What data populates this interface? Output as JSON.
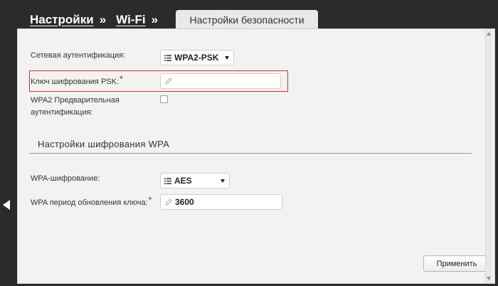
{
  "breadcrumb": {
    "items": [
      "Настройки",
      "Wi-Fi"
    ],
    "separator": "»"
  },
  "active_tab": "Настройки безопасности",
  "form": {
    "network_auth": {
      "label": "Сетевая аутентификация:",
      "value": "WPA2-PSK"
    },
    "psk_key": {
      "label": "Ключ шифрования PSK:",
      "required_mark": "*",
      "value": ""
    },
    "preauth": {
      "label_line1": "WPA2 Предварительная",
      "label_line2": "аутентификация:",
      "checked": false
    }
  },
  "wpa_section": {
    "title": "Настройки шифрования WPA",
    "encryption": {
      "label": "WPA-шифрование:",
      "value": "AES"
    },
    "key_update": {
      "label": "WPA период обновления ключа:",
      "required_mark": "*",
      "value": "3600"
    }
  },
  "apply_button": "Применить",
  "colors": {
    "background": "#2b2b2b",
    "panel": "#f2f2f2",
    "highlight_border": "#d32f2f",
    "required": "#d00000"
  },
  "icons": [
    "list-icon",
    "pencil-icon",
    "caret-down-icon",
    "chevron-left-icon",
    "scroll-up-arrow-icon",
    "scroll-down-arrow-icon"
  ]
}
